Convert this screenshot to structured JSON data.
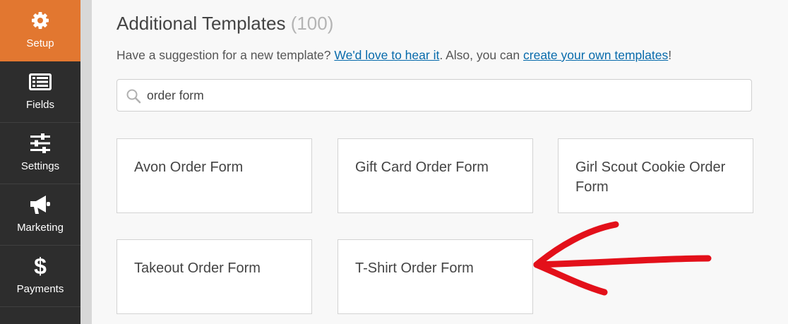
{
  "sidebar": {
    "items": [
      {
        "label": "Setup",
        "icon": "gear-icon",
        "active": true
      },
      {
        "label": "Fields",
        "icon": "list-icon"
      },
      {
        "label": "Settings",
        "icon": "sliders-icon"
      },
      {
        "label": "Marketing",
        "icon": "megaphone-icon"
      },
      {
        "label": "Payments",
        "icon": "dollar-icon"
      }
    ]
  },
  "main": {
    "title": "Additional Templates",
    "count": "(100)",
    "subtitle_prefix": "Have a suggestion for a new template? ",
    "love_link": "We'd love to hear it",
    "subtitle_middle": ". Also, you can ",
    "create_link": "create your own templates",
    "subtitle_suffix": "!",
    "search": {
      "value": "order form",
      "icon": "search-icon"
    },
    "templates": [
      "Avon Order Form",
      "Gift Card Order Form",
      "Girl Scout Cookie Order Form",
      "Takeout Order Form",
      "T-Shirt Order Form"
    ]
  },
  "colors": {
    "accent": "#e27730",
    "sidebar": "#2d2d2d",
    "link": "#066aab",
    "annotation_arrow": "#e3101a"
  }
}
